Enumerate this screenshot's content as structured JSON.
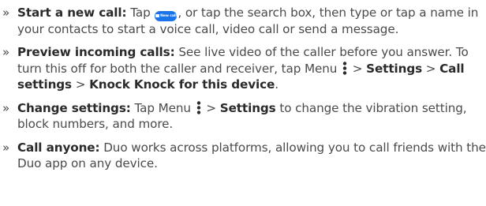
{
  "bullet": "»",
  "items": [
    {
      "title": "Start a new call:",
      "text1": " Tap ",
      "icon": "new-call-button-icon",
      "icon_label": "New call",
      "text2": ", or tap the search box, then type or tap a name in your contacts to start a voice call, video call or send a message."
    },
    {
      "title": "Preview incoming calls:",
      "text1": " See live video of the caller before you answer. To turn this off for both the caller and receiver, tap Menu ",
      "icon": "menu-icon",
      "text2": " > ",
      "bold1": "Settings",
      "text3": " > ",
      "bold2": "Call settings",
      "text4": " > ",
      "bold3": "Knock Knock for this device",
      "text5": "."
    },
    {
      "title": "Change settings:",
      "text1": " Tap Menu ",
      "icon": "menu-icon",
      "text2": " > ",
      "bold1": "Settings",
      "text3": " to change the vibration setting, block numbers, and more."
    },
    {
      "title": "Call anyone:",
      "text1": " Duo works across platforms, allowing you to call friends with the Duo app on any device."
    }
  ]
}
